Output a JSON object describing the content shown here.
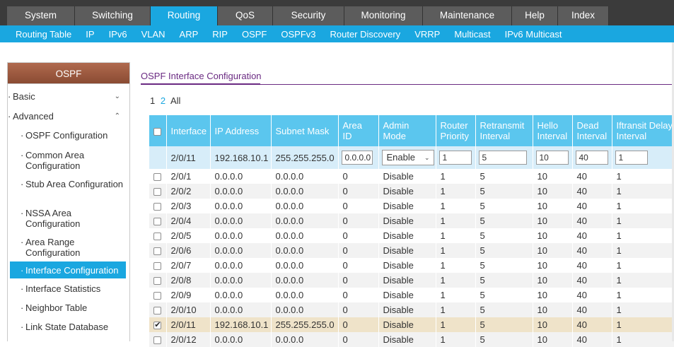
{
  "main_nav": [
    "System",
    "Switching",
    "Routing",
    "QoS",
    "Security",
    "Monitoring",
    "Maintenance",
    "Help",
    "Index"
  ],
  "main_nav_active": "Routing",
  "sub_nav": [
    "Routing Table",
    "IP",
    "IPv6",
    "VLAN",
    "ARP",
    "RIP",
    "OSPF",
    "OSPFv3",
    "Router Discovery",
    "VRRP",
    "Multicast",
    "IPv6 Multicast"
  ],
  "sub_nav_active": "OSPF",
  "sidebar": {
    "title": "OSPF",
    "items": [
      {
        "label": "Basic",
        "level": 0
      },
      {
        "label": "Advanced",
        "level": 0
      },
      {
        "label": "OSPF Configuration",
        "level": 1
      },
      {
        "label": "Common Area Configuration",
        "level": 1
      },
      {
        "label": "Stub Area Configuration",
        "level": 1
      },
      {
        "label": "NSSA Area Configuration",
        "level": 1
      },
      {
        "label": "Area Range Configuration",
        "level": 1
      },
      {
        "label": "Interface Configuration",
        "level": 1,
        "active": true
      },
      {
        "label": "Interface Statistics",
        "level": 1
      },
      {
        "label": "Neighbor Table",
        "level": 1
      },
      {
        "label": "Link State Database",
        "level": 1
      }
    ]
  },
  "content": {
    "title": "OSPF Interface Configuration",
    "pager": [
      "1",
      "2",
      "All"
    ],
    "columns": [
      "Interface",
      "IP Address",
      "Subnet Mask",
      "Area ID",
      "Admin Mode",
      "Router Priority",
      "Retransmit Interval",
      "Hello Interval",
      "Dead Interval",
      "Iftransit Delay Interval"
    ],
    "edit_row": {
      "interface": "2/0/11",
      "ip": "192.168.10.1",
      "mask": "255.255.255.0",
      "area_id": "0.0.0.0",
      "admin_mode": "Enable",
      "router_priority": "1",
      "retransmit": "5",
      "hello": "10",
      "dead": "40",
      "transit_delay": "1"
    },
    "rows": [
      {
        "interface": "2/0/1",
        "ip": "0.0.0.0",
        "mask": "0.0.0.0",
        "area": "0",
        "admin": "Disable",
        "priority": "1",
        "retransmit": "5",
        "hello": "10",
        "dead": "40",
        "delay": "1",
        "checked": false
      },
      {
        "interface": "2/0/2",
        "ip": "0.0.0.0",
        "mask": "0.0.0.0",
        "area": "0",
        "admin": "Disable",
        "priority": "1",
        "retransmit": "5",
        "hello": "10",
        "dead": "40",
        "delay": "1",
        "checked": false
      },
      {
        "interface": "2/0/3",
        "ip": "0.0.0.0",
        "mask": "0.0.0.0",
        "area": "0",
        "admin": "Disable",
        "priority": "1",
        "retransmit": "5",
        "hello": "10",
        "dead": "40",
        "delay": "1",
        "checked": false
      },
      {
        "interface": "2/0/4",
        "ip": "0.0.0.0",
        "mask": "0.0.0.0",
        "area": "0",
        "admin": "Disable",
        "priority": "1",
        "retransmit": "5",
        "hello": "10",
        "dead": "40",
        "delay": "1",
        "checked": false
      },
      {
        "interface": "2/0/5",
        "ip": "0.0.0.0",
        "mask": "0.0.0.0",
        "area": "0",
        "admin": "Disable",
        "priority": "1",
        "retransmit": "5",
        "hello": "10",
        "dead": "40",
        "delay": "1",
        "checked": false
      },
      {
        "interface": "2/0/6",
        "ip": "0.0.0.0",
        "mask": "0.0.0.0",
        "area": "0",
        "admin": "Disable",
        "priority": "1",
        "retransmit": "5",
        "hello": "10",
        "dead": "40",
        "delay": "1",
        "checked": false
      },
      {
        "interface": "2/0/7",
        "ip": "0.0.0.0",
        "mask": "0.0.0.0",
        "area": "0",
        "admin": "Disable",
        "priority": "1",
        "retransmit": "5",
        "hello": "10",
        "dead": "40",
        "delay": "1",
        "checked": false
      },
      {
        "interface": "2/0/8",
        "ip": "0.0.0.0",
        "mask": "0.0.0.0",
        "area": "0",
        "admin": "Disable",
        "priority": "1",
        "retransmit": "5",
        "hello": "10",
        "dead": "40",
        "delay": "1",
        "checked": false
      },
      {
        "interface": "2/0/9",
        "ip": "0.0.0.0",
        "mask": "0.0.0.0",
        "area": "0",
        "admin": "Disable",
        "priority": "1",
        "retransmit": "5",
        "hello": "10",
        "dead": "40",
        "delay": "1",
        "checked": false
      },
      {
        "interface": "2/0/10",
        "ip": "0.0.0.0",
        "mask": "0.0.0.0",
        "area": "0",
        "admin": "Disable",
        "priority": "1",
        "retransmit": "5",
        "hello": "10",
        "dead": "40",
        "delay": "1",
        "checked": false
      },
      {
        "interface": "2/0/11",
        "ip": "192.168.10.1",
        "mask": "255.255.255.0",
        "area": "0",
        "admin": "Disable",
        "priority": "1",
        "retransmit": "5",
        "hello": "10",
        "dead": "40",
        "delay": "1",
        "checked": true
      },
      {
        "interface": "2/0/12",
        "ip": "0.0.0.0",
        "mask": "0.0.0.0",
        "area": "0",
        "admin": "Disable",
        "priority": "1",
        "retransmit": "5",
        "hello": "10",
        "dead": "40",
        "delay": "1",
        "checked": false
      }
    ]
  },
  "colors": {
    "nav_bg": "#3b3b3b",
    "nav_tab": "#5c5c5c",
    "accent": "#1aa7e0",
    "header_bg": "#5bc6ee",
    "sidebar_title": "#9b5a40",
    "title_purple": "#6a2a82",
    "selected_row": "#efe3c9"
  },
  "icons": {
    "collapsed": "chevron-down-icon",
    "expanded": "chevron-up-icon",
    "select": "chevron-down-icon"
  }
}
